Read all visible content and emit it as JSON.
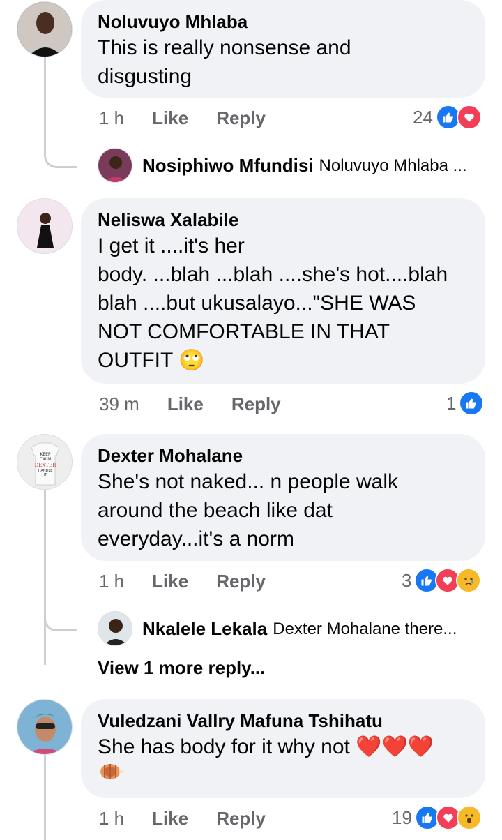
{
  "comments": [
    {
      "author": "Noluvuyo Mhlaba",
      "lines": [
        "This is really nonsense and",
        "disgusting"
      ],
      "time": "1 h",
      "like": "Like",
      "reply": "Reply",
      "reaction_count": "24",
      "reactions": [
        "like-icon",
        "love-icon"
      ],
      "reply_preview": {
        "author": "Nosiphiwo Mfundisi",
        "text": "Noluvuyo Mhlaba ..."
      }
    },
    {
      "author": "Neliswa Xalabile",
      "lines": [
        "I get it ....it's her",
        "body. ...blah ...blah ....she's hot....blah",
        "blah ....but ukusalayo...\"SHE WAS",
        "NOT COMFORTABLE IN THAT",
        "OUTFIT"
      ],
      "emoji": "🙄",
      "time": "39 m",
      "like": "Like",
      "reply": "Reply",
      "reaction_count": "1",
      "reactions": [
        "like-icon"
      ]
    },
    {
      "author": "Dexter Mohalane",
      "avatar_text": [
        "KEEP",
        "CALM",
        "DEXTER",
        "HANDLE",
        "IT"
      ],
      "lines": [
        "She's not naked... n people walk",
        "around the beach like dat",
        "everyday...it's a norm"
      ],
      "time": "1 h",
      "like": "Like",
      "reply": "Reply",
      "reaction_count": "3",
      "reactions": [
        "like-icon",
        "love-icon",
        "sad-icon"
      ],
      "reply_preview": {
        "author": "Nkalele Lekala",
        "text": "Dexter Mohalane there..."
      },
      "view_more": "View 1 more reply..."
    },
    {
      "author": "Vuledzani Vallry Mafuna Tshihatu",
      "lines": [
        "She has body for it why not"
      ],
      "hearts": "❤️❤️❤️",
      "time": "1 h",
      "like": "Like",
      "reply": "Reply",
      "reaction_count": "19",
      "reactions": [
        "like-icon",
        "love-icon",
        "wow-icon"
      ]
    }
  ],
  "colors": {
    "bubble": "#f0f2f5",
    "like": "#1877f2",
    "love": "#f33e58",
    "meta": "#65676b"
  }
}
